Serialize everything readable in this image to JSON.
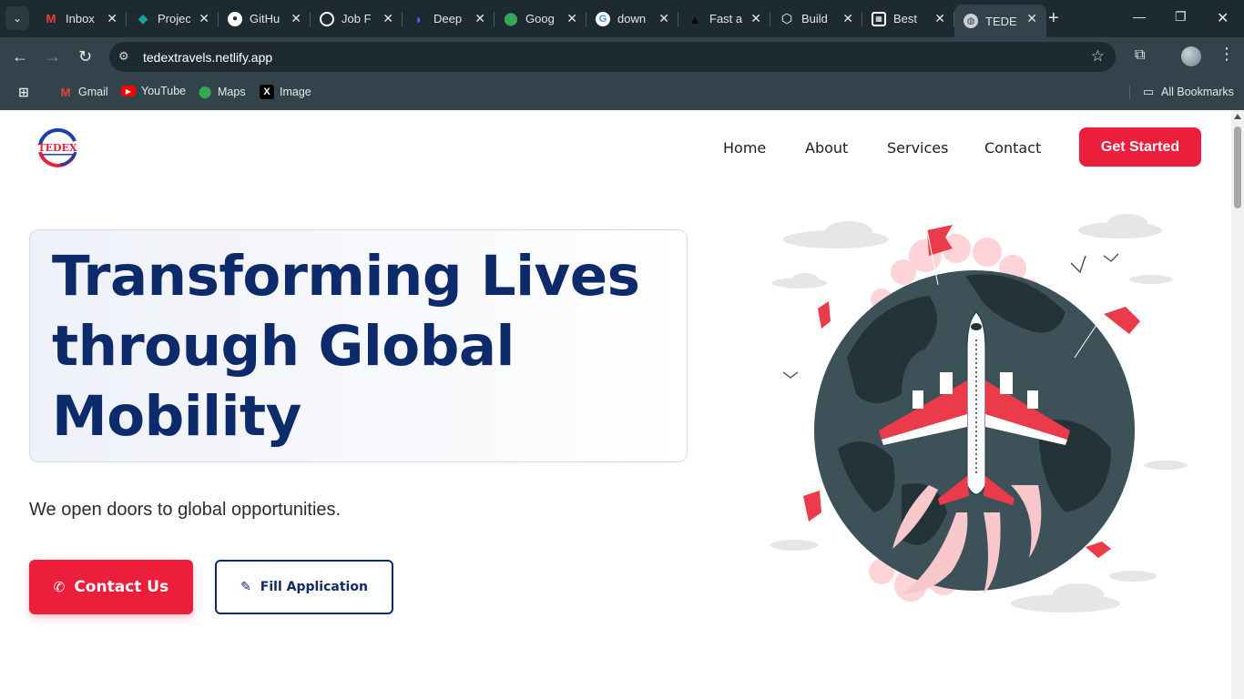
{
  "browser": {
    "tabs": [
      {
        "label": "Inbox",
        "icon": "gmail-icon",
        "color": "#ea4335"
      },
      {
        "label": "Projec",
        "icon": "diamond-icon",
        "color": "#1aa39a"
      },
      {
        "label": "GitHu",
        "icon": "github-icon",
        "color": "#ffffff"
      },
      {
        "label": "Job F",
        "icon": "openai-icon",
        "color": "#ffffff"
      },
      {
        "label": "Deep",
        "icon": "deepseek-icon",
        "color": "#4d6bfe"
      },
      {
        "label": "Goog",
        "icon": "maps-pin-icon",
        "color": "#34a853"
      },
      {
        "label": "down",
        "icon": "google-icon",
        "color": "#4285f4"
      },
      {
        "label": "Fast a",
        "icon": "bird-icon",
        "color": "#111111"
      },
      {
        "label": "Build",
        "icon": "cube-icon",
        "color": "#ffffff"
      },
      {
        "label": "Best",
        "icon": "grid-icon",
        "color": "#ffffff"
      },
      {
        "label": "TEDE",
        "icon": "globe-icon",
        "color": "#c8d0d4"
      }
    ],
    "url": "tedextravels.netlify.app",
    "bookmarks": [
      {
        "label": "Gmail",
        "icon": "gmail-icon"
      },
      {
        "label": "YouTube",
        "icon": "youtube-icon"
      },
      {
        "label": "Maps",
        "icon": "maps-pin-icon"
      },
      {
        "label": "Image",
        "icon": "x-icon"
      }
    ],
    "all_bookmarks": "All Bookmarks"
  },
  "site": {
    "logo_text": "TEDEX",
    "nav": [
      "Home",
      "About",
      "Services",
      "Contact"
    ],
    "cta": "Get Started",
    "hero": {
      "title": "Transforming Lives through Global Mobility",
      "subtitle": "We open doors to global opportunities.",
      "contact_button": "Contact Us",
      "fill_button": "Fill Application"
    },
    "colors": {
      "primary": "#eb1e3c",
      "navy": "#0d2a6b"
    }
  }
}
